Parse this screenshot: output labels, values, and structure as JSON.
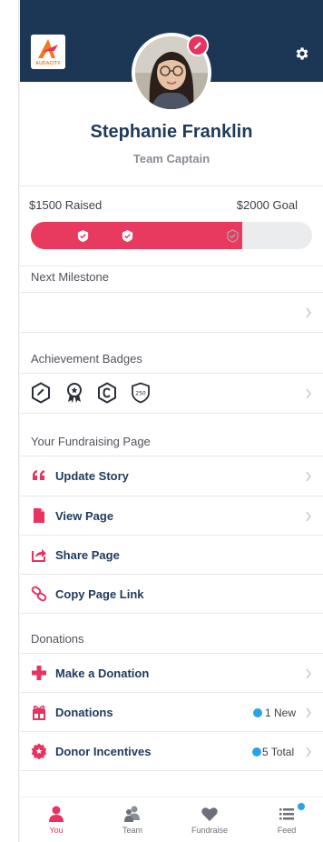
{
  "profile": {
    "name": "Stephanie Franklin",
    "role": "Team Captain",
    "logo_text": "AUDACITY"
  },
  "progress": {
    "raised_label": "$1500 Raised",
    "goal_label": "$2000 Goal",
    "raised": 1500,
    "goal": 2000,
    "fraction": 0.75
  },
  "sections": {
    "next_milestone": "Next Milestone",
    "achievement_badges": "Achievement Badges",
    "fundraising_page": "Your Fundraising Page",
    "donations": "Donations"
  },
  "badges": {
    "items": [
      "pencil-hexagon-badge",
      "ribbon-award-badge",
      "c-badge",
      "250-shield-badge"
    ],
    "shield_text": "250"
  },
  "fundraising_items": [
    {
      "label": "Update Story",
      "icon": "quote-icon"
    },
    {
      "label": "View Page",
      "icon": "document-icon"
    },
    {
      "label": "Share Page",
      "icon": "share-icon"
    },
    {
      "label": "Copy Page Link",
      "icon": "link-icon"
    }
  ],
  "donation_items": [
    {
      "label": "Make a Donation",
      "icon": "plus-icon",
      "status": ""
    },
    {
      "label": "Donations",
      "icon": "gift-icon",
      "status": "1 New"
    },
    {
      "label": "Donor Incentives",
      "icon": "star-badge-icon",
      "status": "5 Total"
    }
  ],
  "tabs": [
    {
      "label": "You",
      "icon": "person-icon",
      "active": true
    },
    {
      "label": "Team",
      "icon": "team-icon",
      "active": false
    },
    {
      "label": "Fundraise",
      "icon": "heart-icon",
      "active": false
    },
    {
      "label": "Feed",
      "icon": "list-icon",
      "active": false
    }
  ],
  "colors": {
    "header": "#1c3656",
    "accent": "#e8325f",
    "navy_text": "#1e3a5c",
    "notification": "#2aa3e6"
  }
}
